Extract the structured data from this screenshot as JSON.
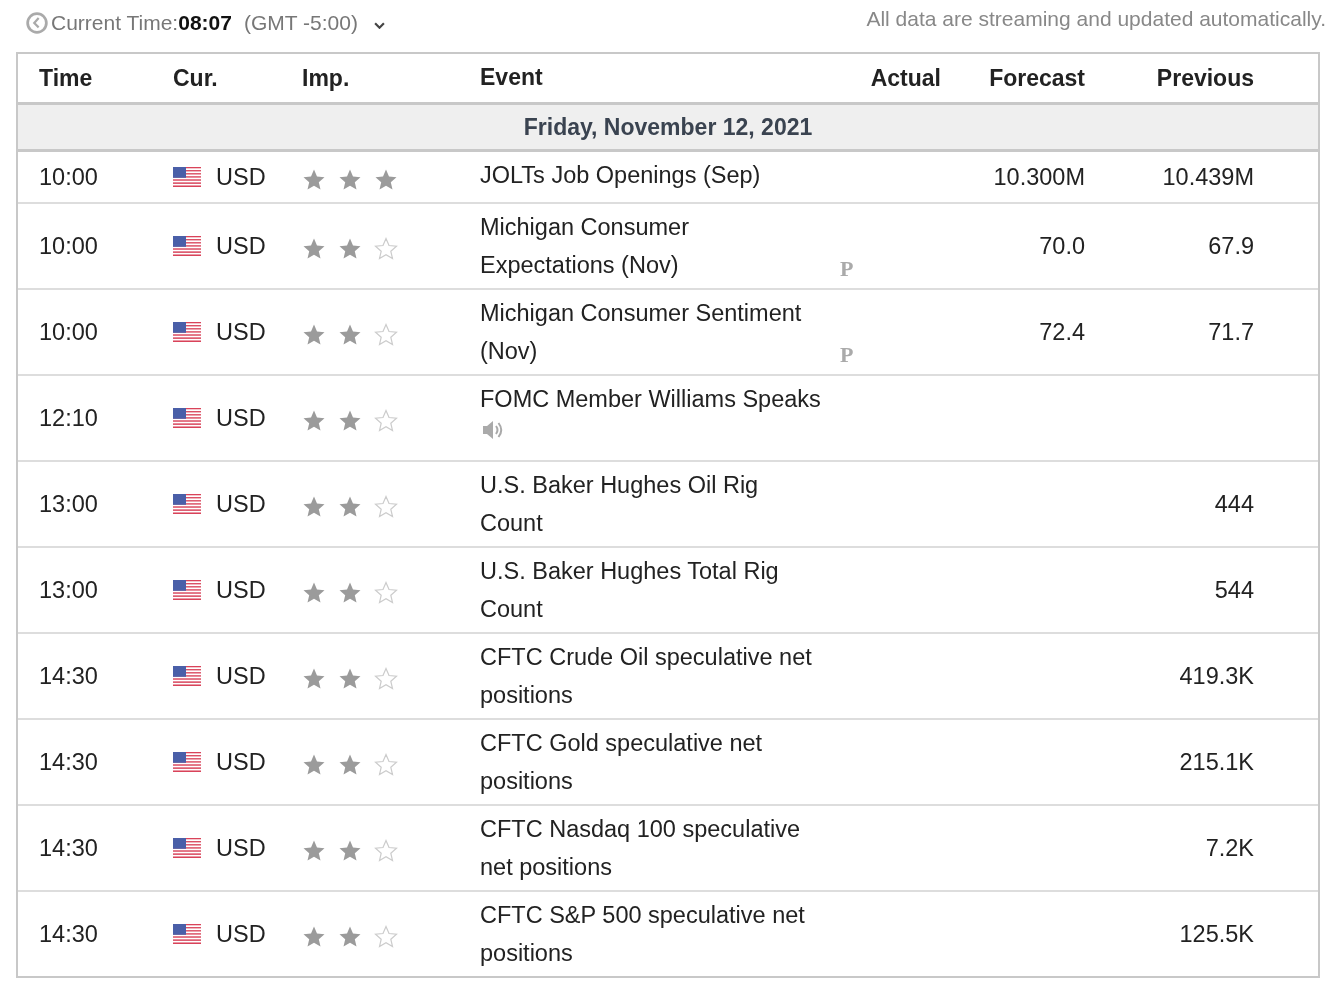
{
  "header": {
    "clock_label": "Current Time:",
    "time": "08:07",
    "timezone": "(GMT -5:00)",
    "notice": "All data are streaming and updated automatically."
  },
  "table": {
    "columns": [
      "Time",
      "Cur.",
      "Imp.",
      "Event",
      "Actual",
      "Forecast",
      "Previous"
    ],
    "date": "Friday, November 12, 2021",
    "rows": [
      {
        "time": "10:00",
        "currency": "USD",
        "stars": 3,
        "event": "JOLTs Job Openings (Sep)",
        "actual": "",
        "forecast": "10.300M",
        "previous": "10.439M"
      },
      {
        "time": "10:00",
        "currency": "USD",
        "stars": 2,
        "event": "Michigan Consumer Expectations (Nov)",
        "marker": {
          "kind": "preliminary",
          "label": "P"
        },
        "actual": "",
        "forecast": "70.0",
        "previous": "67.9"
      },
      {
        "time": "10:00",
        "currency": "USD",
        "stars": 2,
        "event": "Michigan Consumer Sentiment (Nov)",
        "marker": {
          "kind": "preliminary",
          "label": "P"
        },
        "actual": "",
        "forecast": "72.4",
        "previous": "71.7"
      },
      {
        "time": "12:10",
        "currency": "USD",
        "stars": 2,
        "event": "FOMC Member Williams Speaks",
        "marker": {
          "kind": "speech"
        },
        "actual": "",
        "forecast": "",
        "previous": ""
      },
      {
        "time": "13:00",
        "currency": "USD",
        "stars": 2,
        "event": "U.S. Baker Hughes Oil Rig Count",
        "actual": "",
        "forecast": "",
        "previous": "444"
      },
      {
        "time": "13:00",
        "currency": "USD",
        "stars": 2,
        "event": "U.S. Baker Hughes Total Rig Count",
        "actual": "",
        "forecast": "",
        "previous": "544"
      },
      {
        "time": "14:30",
        "currency": "USD",
        "stars": 2,
        "event": "CFTC Crude Oil speculative net positions",
        "actual": "",
        "forecast": "",
        "previous": "419.3K"
      },
      {
        "time": "14:30",
        "currency": "USD",
        "stars": 2,
        "event": "CFTC Gold speculative net positions",
        "actual": "",
        "forecast": "",
        "previous": "215.1K"
      },
      {
        "time": "14:30",
        "currency": "USD",
        "stars": 2,
        "event": "CFTC Nasdaq 100 speculative net positions",
        "actual": "",
        "forecast": "",
        "previous": "7.2K"
      },
      {
        "time": "14:30",
        "currency": "USD",
        "stars": 2,
        "event": "CFTC S&P 500 speculative net positions",
        "actual": "",
        "forecast": "",
        "previous": "125.5K"
      }
    ]
  }
}
